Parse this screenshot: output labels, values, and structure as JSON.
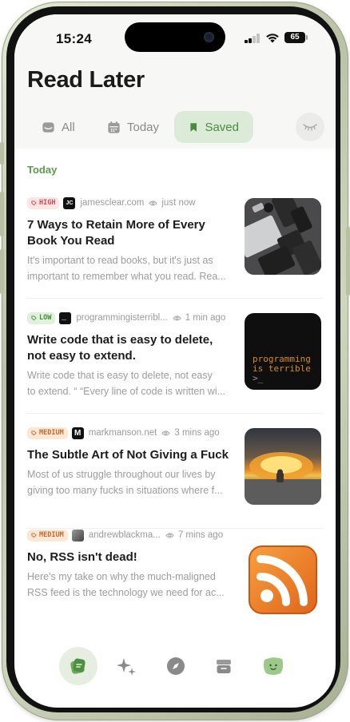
{
  "status_bar": {
    "time": "15:24",
    "battery": "65"
  },
  "header": {
    "title": "Read Later"
  },
  "tabs": [
    {
      "label": "All",
      "icon": "tray-icon"
    },
    {
      "label": "Today",
      "icon": "calendar-icon"
    },
    {
      "label": "Saved",
      "icon": "bookmark-icon",
      "active": true
    }
  ],
  "section": {
    "label": "Today"
  },
  "articles": [
    {
      "priority": "HIGH",
      "site": "jamesclear.com",
      "favicon": "JC",
      "time": "just now",
      "title": "7 Ways to Retain More of Every Book You Read",
      "desc_line1": "It's important to read books, but it's just as",
      "desc_line2": "important to remember what you read. Rea..."
    },
    {
      "priority": "LOW",
      "site": "programmingisterribl...",
      "favicon": "",
      "time": "1 min ago",
      "title": "Write code that is easy to delete, not easy to extend.",
      "desc_line1": "Write code that is easy to delete, not easy",
      "desc_line2": "to extend. “ “Every line of code is written wi...",
      "thumb_text_line1": "programming",
      "thumb_text_line2": "is terrible",
      "thumb_text_line3": ">_"
    },
    {
      "priority": "MEDIUM",
      "site": "markmanson.net",
      "favicon": "M",
      "time": "3 mins ago",
      "title": "The Subtle Art of Not Giving a Fuck",
      "desc_line1": "Most of us struggle throughout our lives by",
      "desc_line2": "giving too many fucks in situations where f..."
    },
    {
      "priority": "MEDIUM",
      "site": "andrewblackma...",
      "favicon": "",
      "time": "7 mins ago",
      "title": "No, RSS isn't dead!",
      "desc_line1": "Here's my take on why the much-maligned",
      "desc_line2": "RSS feed is the technology we need for ac..."
    }
  ],
  "bottom_nav": [
    {
      "icon": "read-later-icon",
      "active": true
    },
    {
      "icon": "sparkles-icon"
    },
    {
      "icon": "compass-icon"
    },
    {
      "icon": "archive-icon"
    },
    {
      "icon": "avatar-blob-icon"
    }
  ],
  "colors": {
    "accent_green": "#5d9a4c",
    "saved_tab_bg": "#dcebd7",
    "high": "#c84b4b",
    "low": "#4a8a3a",
    "medium": "#c26a2e",
    "rss_orange": "#f07a1a"
  }
}
